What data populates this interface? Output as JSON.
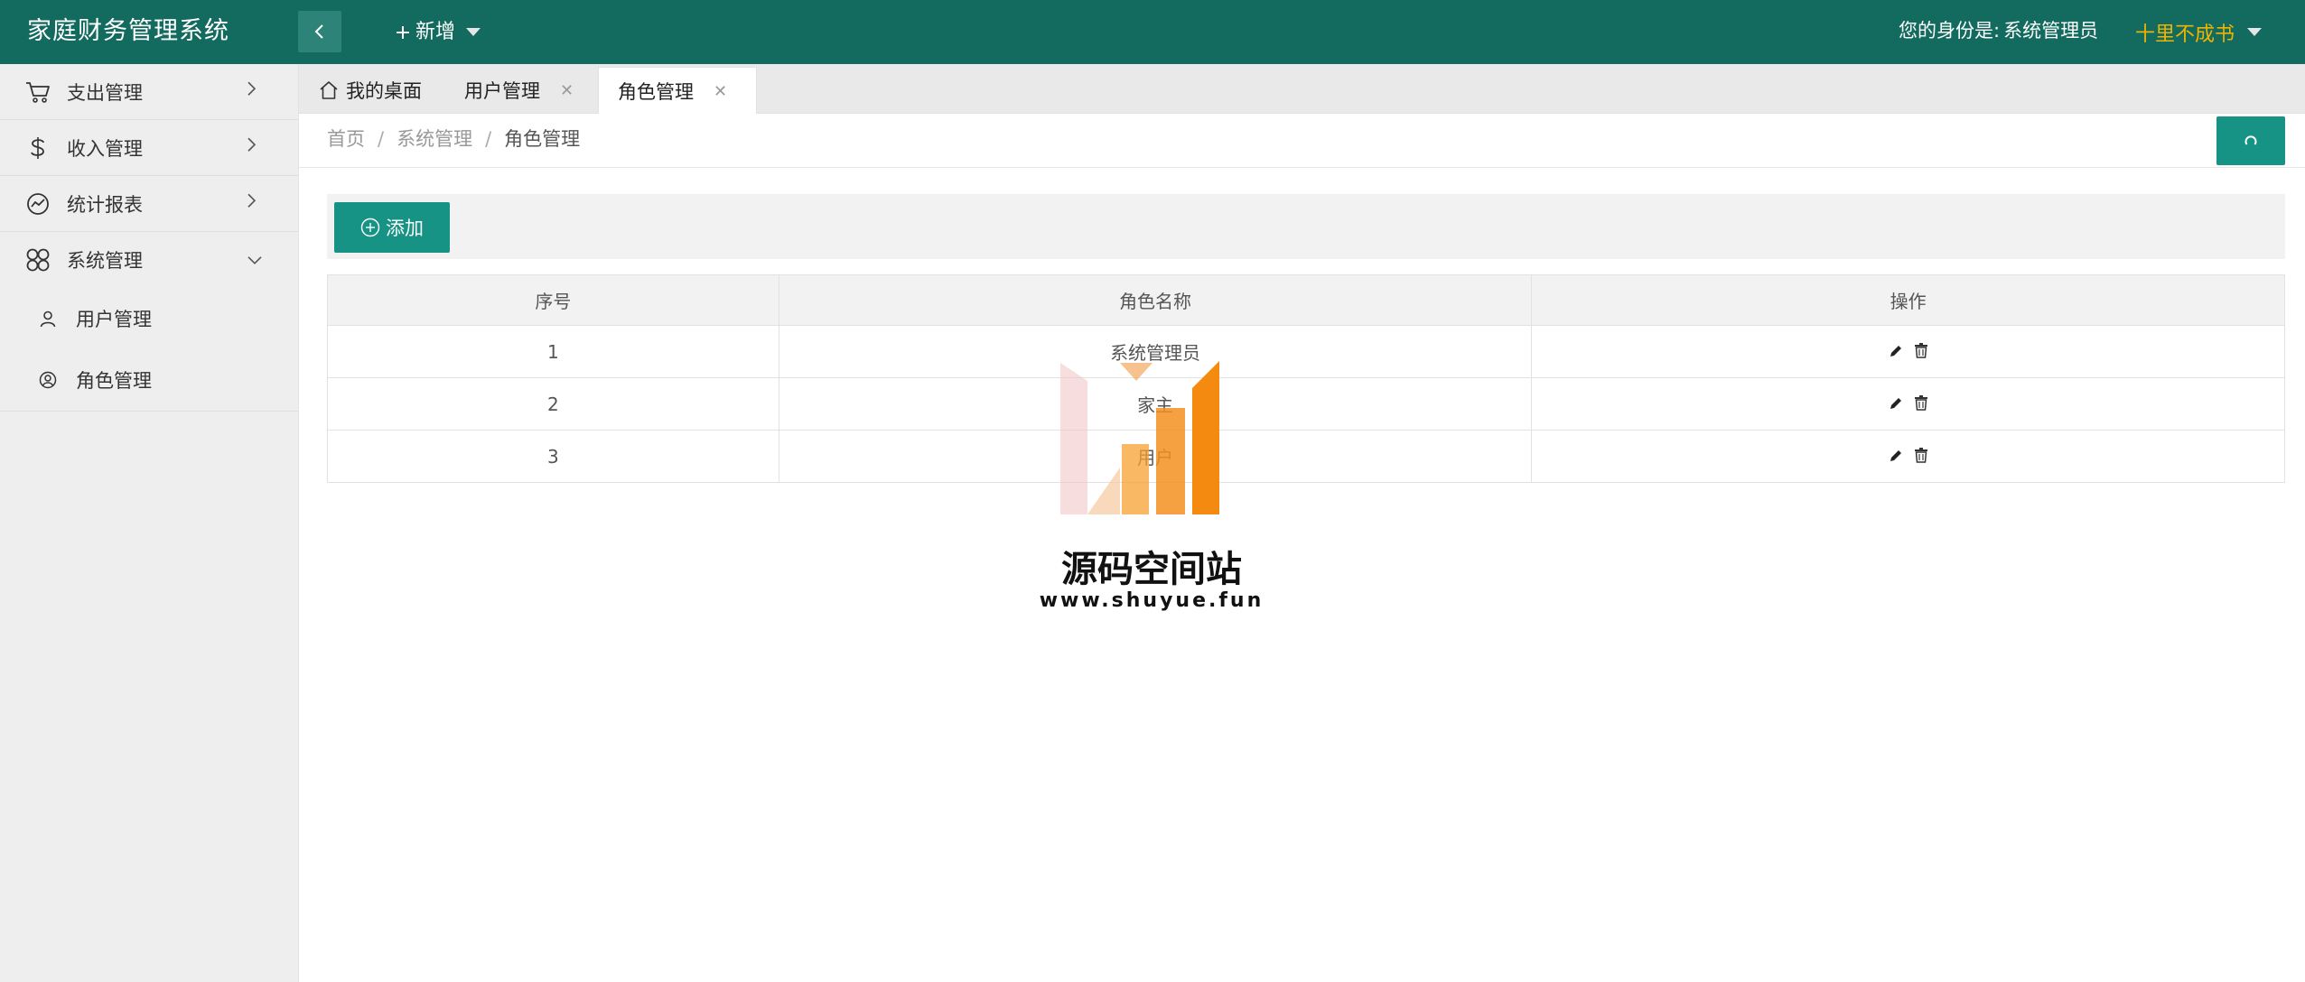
{
  "app": {
    "title": "家庭财务管理系统",
    "new_label": "新增",
    "identity_prefix": "您的身份是:",
    "identity_role": "系统管理员",
    "username": "十里不成书"
  },
  "colors": {
    "header_bg": "#136a5e",
    "primary": "#169384",
    "username": "#f0b400",
    "sidebar_bg": "#eeeeee"
  },
  "sidebar": {
    "items": [
      {
        "label": "支出管理",
        "icon": "cart-icon",
        "expanded": false
      },
      {
        "label": "收入管理",
        "icon": "dollar-icon",
        "expanded": false
      },
      {
        "label": "统计报表",
        "icon": "chart-icon",
        "expanded": false
      },
      {
        "label": "系统管理",
        "icon": "grid-icon",
        "expanded": true
      }
    ],
    "subitems": [
      {
        "label": "用户管理",
        "icon": "user-icon"
      },
      {
        "label": "角色管理",
        "icon": "user-circle-icon"
      }
    ]
  },
  "tabs": [
    {
      "label": "我的桌面",
      "icon": "home-icon",
      "closable": false,
      "active": false
    },
    {
      "label": "用户管理",
      "closable": true,
      "active": false
    },
    {
      "label": "角色管理",
      "closable": true,
      "active": true
    }
  ],
  "tab_close": "✕",
  "breadcrumb": {
    "items": [
      "首页",
      "系统管理",
      "角色管理"
    ],
    "separator": "/"
  },
  "toolbar": {
    "add_label": "添加"
  },
  "table": {
    "columns": [
      "序号",
      "角色名称",
      "操作"
    ],
    "rows": [
      {
        "index": "1",
        "name": "系统管理员"
      },
      {
        "index": "2",
        "name": "家主"
      },
      {
        "index": "3",
        "name": "用户"
      }
    ]
  },
  "watermark": {
    "title": "源码空间站",
    "url": "www.shuyue.fun"
  }
}
